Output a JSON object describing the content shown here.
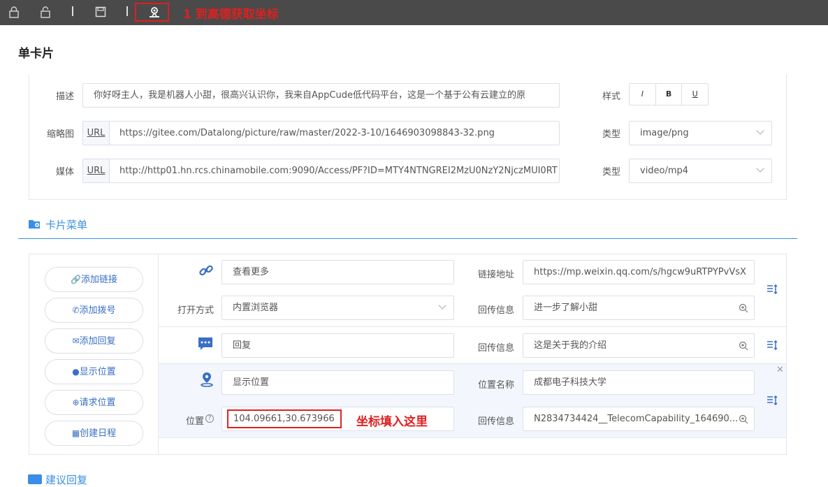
{
  "toolbar": {
    "icons": [
      "lock-icon",
      "unlock-icon",
      "separator",
      "save-icon",
      "separator",
      "map-location-icon"
    ],
    "annotation": "1 到高德获取坐标"
  },
  "page_title": "单卡片",
  "card": {
    "desc_label": "描述",
    "desc_value": "你好呀主人，我是机器人小甜，很高兴认识你，我来自AppCude低代码平台，这是一个基于公有云建立的原",
    "style_label": "样式",
    "style_buttons": [
      "I",
      "B",
      "U"
    ],
    "thumb_label": "缩略图",
    "thumb_prefix": "URL",
    "thumb_value": "https://gitee.com/Datalong/picture/raw/master/2022-3-10/1646903098843-32.png",
    "thumb_type_label": "类型",
    "thumb_type_value": "image/png",
    "media_label": "媒体",
    "media_prefix": "URL",
    "media_value": "http://http01.hn.rcs.chinamobile.com:9090/Access/PF?ID=MTY4NTNGREI2MzU0NzY2NjczMUI0RT",
    "media_type_label": "类型",
    "media_type_value": "video/mp4"
  },
  "menu_section": {
    "title": "卡片菜单",
    "buttons": [
      "添加链接",
      "添加拨号",
      "添加回复",
      "显示位置",
      "请求位置",
      "创建日程"
    ],
    "rows": [
      {
        "type": "link",
        "name_value": "查看更多",
        "right_label": "链接地址",
        "right_value": "https://mp.weixin.qq.com/s/hgcw9uRTPYPvVsX",
        "open_label": "打开方式",
        "open_value": "内置浏览器",
        "callback_label": "回传信息",
        "callback_value": "进一步了解小甜"
      },
      {
        "type": "reply",
        "name_value": "回复",
        "callback_label": "回传信息",
        "callback_value": "这是关于我的介绍"
      },
      {
        "type": "location",
        "name_value": "显示位置",
        "place_label": "位置名称",
        "place_value": "成都电子科技大学",
        "pos_label": "位置",
        "pos_value": "104.09661,30.673966",
        "callback_label": "回传信息",
        "callback_value": "N2834734424__TelecomCapability_164690..."
      }
    ],
    "annotation": "坐标填入这里"
  },
  "next_section": {
    "title": "建议回复"
  },
  "colors": {
    "accent": "#3a8ee6",
    "annotation": "#e02020",
    "toolbar": "#4a4a4a",
    "row_highlight": "#f3f7fd"
  }
}
